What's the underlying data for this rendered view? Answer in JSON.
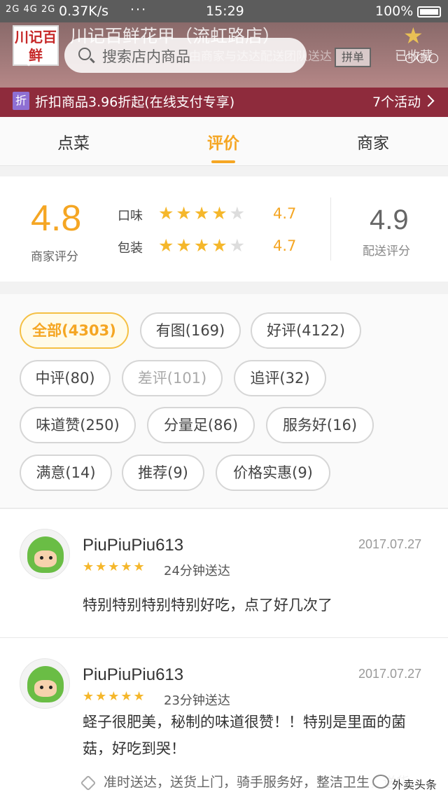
{
  "status_bar": {
    "signal": "2G 4G 2G",
    "speed": "0.37K/s",
    "more": "···",
    "time": "15:29",
    "battery": "100%"
  },
  "header": {
    "logo_text": "川记百鲜",
    "store_name": "川记百鲜花甲（流虹路店）",
    "search_placeholder": "搜索店内商品",
    "subtitle": "由商家与达达配送团队送达",
    "pin_label": "拼单",
    "fav_label": "已收藏"
  },
  "discount": {
    "tag": "折",
    "text": "折扣商品3.96折起(在线支付专享)",
    "count": "7个活动"
  },
  "tabs": [
    {
      "label": "点菜"
    },
    {
      "label": "评价"
    },
    {
      "label": "商家"
    }
  ],
  "rating": {
    "score": "4.8",
    "score_label": "商家评分",
    "rows": [
      {
        "label": "口味",
        "value": "4.7",
        "stars": 4.7
      },
      {
        "label": "包装",
        "value": "4.7",
        "stars": 4.7
      }
    ],
    "delivery_score": "4.9",
    "delivery_label": "配送评分"
  },
  "filters": [
    {
      "label": "全部(4303)"
    },
    {
      "label": "有图(169)"
    },
    {
      "label": "好评(4122)"
    },
    {
      "label": "中评(80)"
    },
    {
      "label": "差评(101)"
    },
    {
      "label": "追评(32)"
    },
    {
      "label": "味道赞(250)"
    },
    {
      "label": "分量足(86)"
    },
    {
      "label": "服务好(16)"
    },
    {
      "label": "满意(14)"
    },
    {
      "label": "推荐(9)"
    },
    {
      "label": "价格实惠(9)"
    }
  ],
  "reviews": [
    {
      "user": "PiuPiuPiu613",
      "date": "2017.07.27",
      "stars": "★★★★★",
      "delivery": "24分钟送达",
      "text": "特别特别特别特别好吃，点了好几次了"
    },
    {
      "user": "PiuPiuPiu613",
      "date": "2017.07.27",
      "stars": "★★★★★",
      "delivery": "23分钟送达",
      "text": "蛏子很肥美，秘制的味道很赞！！特别是里面的菌菇，好吃到哭！",
      "tags": "准时送达，送货上门，骑手服务好，整洁卫生，送货"
    }
  ],
  "watermark": "外卖头条",
  "colors": {
    "accent": "#f5a623",
    "discount_bg": "#8e2b3c",
    "star": "#f5b72b"
  }
}
